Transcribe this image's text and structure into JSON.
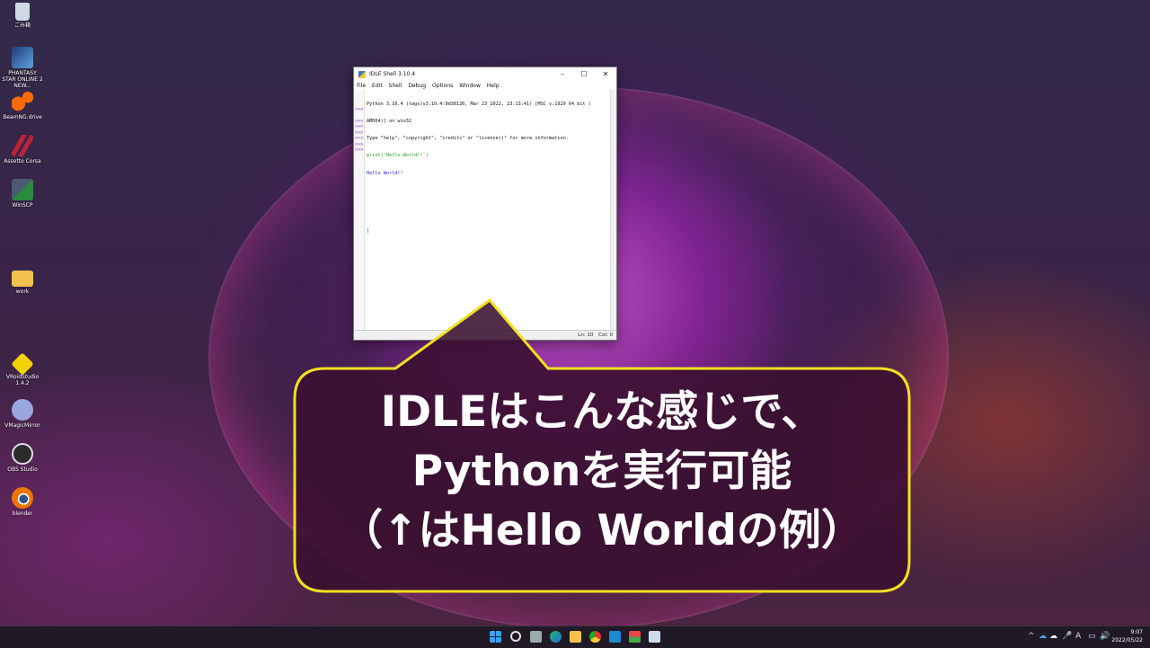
{
  "desktop": {
    "icons": [
      {
        "label": "ごみ箱",
        "icon": "recycle-bin-icon",
        "color": "#cfd8e3"
      },
      {
        "label": "PHANTASY STAR ONLINE 2 NEW...",
        "icon": "pso2-icon",
        "color": "#3a6fb0"
      },
      {
        "label": "BeamNG.drive",
        "icon": "beamng-icon",
        "color": "#ff6a00"
      },
      {
        "label": "Assetto Corsa",
        "icon": "assetto-corsa-icon",
        "color": "#c0223a"
      },
      {
        "label": "WinSCP",
        "icon": "winscp-icon",
        "color": "#2a8a3e"
      },
      {
        "label": "work",
        "icon": "folder-icon",
        "color": "#f2c14e"
      },
      {
        "label": "VRoidStudio 1.4.2",
        "icon": "vroid-icon",
        "color": "#f4d20a"
      },
      {
        "label": "VMagicMirror",
        "icon": "vmagicmirror-icon",
        "color": "#9aa6e0"
      },
      {
        "label": "OBS Studio",
        "icon": "obs-icon",
        "color": "#2b2b2b"
      },
      {
        "label": "blender",
        "icon": "blender-icon",
        "color": "#ea7600"
      }
    ]
  },
  "idle_window": {
    "title": "IDLE Shell 3.10.4",
    "controls": {
      "minimize": "–",
      "maximize": "☐",
      "close": "✕"
    },
    "menu": [
      "File",
      "Edit",
      "Shell",
      "Debug",
      "Options",
      "Window",
      "Help"
    ],
    "shell_lines": {
      "line1": "Python 3.10.4 (tags/v3.10.4:9d38120, Mar 23 2022, 23:13:41) [MSC v.1929 64 bit (",
      "line2": "AMD64)] on win32",
      "line3": "Type \"help\", \"copyright\", \"credits\" or \"license()\" for more information.",
      "code": "print('Hello World!!')",
      "output": "Hello World!!",
      "cursor": "|"
    },
    "prompt": ">>>",
    "status": {
      "line": "Ln: 10",
      "col": "Col: 0"
    }
  },
  "callout": {
    "line1": "IDLEはこんな感じで、",
    "line2": "Pythonを実行可能",
    "line3": "（↑はHello Worldの例）",
    "fill": "#3a1030",
    "border": "#f2e020"
  },
  "taskbar": {
    "apps": [
      "windows-start-icon",
      "search-icon",
      "task-view-icon",
      "edge-icon",
      "file-explorer-icon",
      "chrome-icon",
      "vscode-icon",
      "store-icon",
      "notepad-icon"
    ],
    "tray_icons": [
      "chevron-up-icon",
      "onedrive-icon",
      "onedrive-icon",
      "microphone-icon",
      "font-icon",
      "monitor-icon",
      "speaker-icon"
    ],
    "clock_time": "9:07",
    "clock_date": "2022/05/22",
    "font_indicator": "A"
  }
}
